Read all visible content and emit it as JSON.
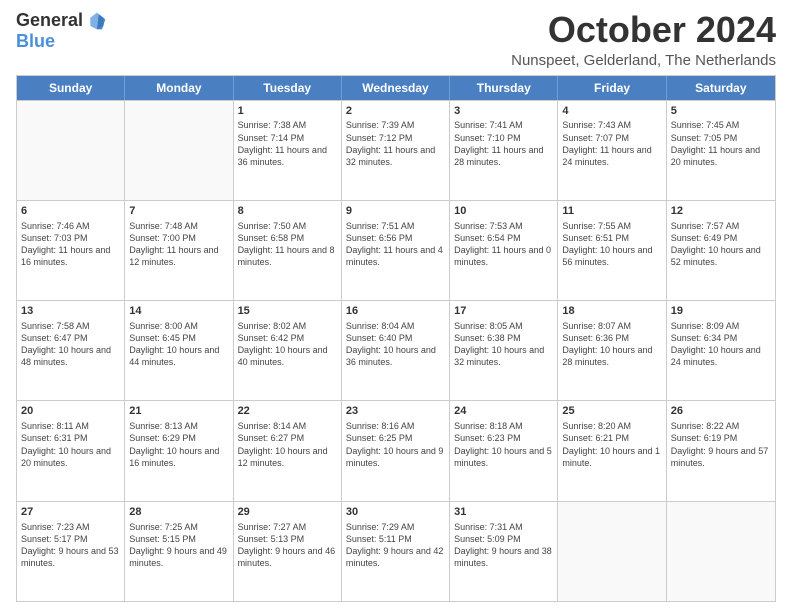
{
  "logo": {
    "general": "General",
    "blue": "Blue"
  },
  "title": "October 2024",
  "location": "Nunspeet, Gelderland, The Netherlands",
  "days": [
    "Sunday",
    "Monday",
    "Tuesday",
    "Wednesday",
    "Thursday",
    "Friday",
    "Saturday"
  ],
  "rows": [
    [
      {
        "day": "",
        "sunrise": "",
        "sunset": "",
        "daylight": "",
        "empty": true
      },
      {
        "day": "",
        "sunrise": "",
        "sunset": "",
        "daylight": "",
        "empty": true
      },
      {
        "day": "1",
        "sunrise": "Sunrise: 7:38 AM",
        "sunset": "Sunset: 7:14 PM",
        "daylight": "Daylight: 11 hours and 36 minutes."
      },
      {
        "day": "2",
        "sunrise": "Sunrise: 7:39 AM",
        "sunset": "Sunset: 7:12 PM",
        "daylight": "Daylight: 11 hours and 32 minutes."
      },
      {
        "day": "3",
        "sunrise": "Sunrise: 7:41 AM",
        "sunset": "Sunset: 7:10 PM",
        "daylight": "Daylight: 11 hours and 28 minutes."
      },
      {
        "day": "4",
        "sunrise": "Sunrise: 7:43 AM",
        "sunset": "Sunset: 7:07 PM",
        "daylight": "Daylight: 11 hours and 24 minutes."
      },
      {
        "day": "5",
        "sunrise": "Sunrise: 7:45 AM",
        "sunset": "Sunset: 7:05 PM",
        "daylight": "Daylight: 11 hours and 20 minutes."
      }
    ],
    [
      {
        "day": "6",
        "sunrise": "Sunrise: 7:46 AM",
        "sunset": "Sunset: 7:03 PM",
        "daylight": "Daylight: 11 hours and 16 minutes."
      },
      {
        "day": "7",
        "sunrise": "Sunrise: 7:48 AM",
        "sunset": "Sunset: 7:00 PM",
        "daylight": "Daylight: 11 hours and 12 minutes."
      },
      {
        "day": "8",
        "sunrise": "Sunrise: 7:50 AM",
        "sunset": "Sunset: 6:58 PM",
        "daylight": "Daylight: 11 hours and 8 minutes."
      },
      {
        "day": "9",
        "sunrise": "Sunrise: 7:51 AM",
        "sunset": "Sunset: 6:56 PM",
        "daylight": "Daylight: 11 hours and 4 minutes."
      },
      {
        "day": "10",
        "sunrise": "Sunrise: 7:53 AM",
        "sunset": "Sunset: 6:54 PM",
        "daylight": "Daylight: 11 hours and 0 minutes."
      },
      {
        "day": "11",
        "sunrise": "Sunrise: 7:55 AM",
        "sunset": "Sunset: 6:51 PM",
        "daylight": "Daylight: 10 hours and 56 minutes."
      },
      {
        "day": "12",
        "sunrise": "Sunrise: 7:57 AM",
        "sunset": "Sunset: 6:49 PM",
        "daylight": "Daylight: 10 hours and 52 minutes."
      }
    ],
    [
      {
        "day": "13",
        "sunrise": "Sunrise: 7:58 AM",
        "sunset": "Sunset: 6:47 PM",
        "daylight": "Daylight: 10 hours and 48 minutes."
      },
      {
        "day": "14",
        "sunrise": "Sunrise: 8:00 AM",
        "sunset": "Sunset: 6:45 PM",
        "daylight": "Daylight: 10 hours and 44 minutes."
      },
      {
        "day": "15",
        "sunrise": "Sunrise: 8:02 AM",
        "sunset": "Sunset: 6:42 PM",
        "daylight": "Daylight: 10 hours and 40 minutes."
      },
      {
        "day": "16",
        "sunrise": "Sunrise: 8:04 AM",
        "sunset": "Sunset: 6:40 PM",
        "daylight": "Daylight: 10 hours and 36 minutes."
      },
      {
        "day": "17",
        "sunrise": "Sunrise: 8:05 AM",
        "sunset": "Sunset: 6:38 PM",
        "daylight": "Daylight: 10 hours and 32 minutes."
      },
      {
        "day": "18",
        "sunrise": "Sunrise: 8:07 AM",
        "sunset": "Sunset: 6:36 PM",
        "daylight": "Daylight: 10 hours and 28 minutes."
      },
      {
        "day": "19",
        "sunrise": "Sunrise: 8:09 AM",
        "sunset": "Sunset: 6:34 PM",
        "daylight": "Daylight: 10 hours and 24 minutes."
      }
    ],
    [
      {
        "day": "20",
        "sunrise": "Sunrise: 8:11 AM",
        "sunset": "Sunset: 6:31 PM",
        "daylight": "Daylight: 10 hours and 20 minutes."
      },
      {
        "day": "21",
        "sunrise": "Sunrise: 8:13 AM",
        "sunset": "Sunset: 6:29 PM",
        "daylight": "Daylight: 10 hours and 16 minutes."
      },
      {
        "day": "22",
        "sunrise": "Sunrise: 8:14 AM",
        "sunset": "Sunset: 6:27 PM",
        "daylight": "Daylight: 10 hours and 12 minutes."
      },
      {
        "day": "23",
        "sunrise": "Sunrise: 8:16 AM",
        "sunset": "Sunset: 6:25 PM",
        "daylight": "Daylight: 10 hours and 9 minutes."
      },
      {
        "day": "24",
        "sunrise": "Sunrise: 8:18 AM",
        "sunset": "Sunset: 6:23 PM",
        "daylight": "Daylight: 10 hours and 5 minutes."
      },
      {
        "day": "25",
        "sunrise": "Sunrise: 8:20 AM",
        "sunset": "Sunset: 6:21 PM",
        "daylight": "Daylight: 10 hours and 1 minute."
      },
      {
        "day": "26",
        "sunrise": "Sunrise: 8:22 AM",
        "sunset": "Sunset: 6:19 PM",
        "daylight": "Daylight: 9 hours and 57 minutes."
      }
    ],
    [
      {
        "day": "27",
        "sunrise": "Sunrise: 7:23 AM",
        "sunset": "Sunset: 5:17 PM",
        "daylight": "Daylight: 9 hours and 53 minutes."
      },
      {
        "day": "28",
        "sunrise": "Sunrise: 7:25 AM",
        "sunset": "Sunset: 5:15 PM",
        "daylight": "Daylight: 9 hours and 49 minutes."
      },
      {
        "day": "29",
        "sunrise": "Sunrise: 7:27 AM",
        "sunset": "Sunset: 5:13 PM",
        "daylight": "Daylight: 9 hours and 46 minutes."
      },
      {
        "day": "30",
        "sunrise": "Sunrise: 7:29 AM",
        "sunset": "Sunset: 5:11 PM",
        "daylight": "Daylight: 9 hours and 42 minutes."
      },
      {
        "day": "31",
        "sunrise": "Sunrise: 7:31 AM",
        "sunset": "Sunset: 5:09 PM",
        "daylight": "Daylight: 9 hours and 38 minutes."
      },
      {
        "day": "",
        "sunrise": "",
        "sunset": "",
        "daylight": "",
        "empty": true
      },
      {
        "day": "",
        "sunrise": "",
        "sunset": "",
        "daylight": "",
        "empty": true
      }
    ]
  ]
}
